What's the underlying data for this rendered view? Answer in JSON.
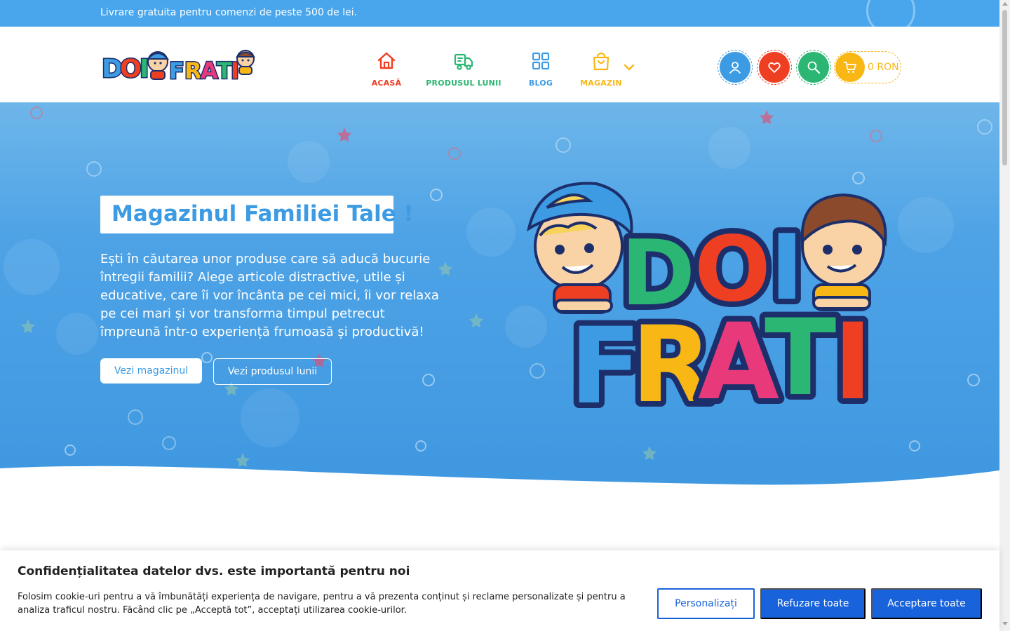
{
  "announcement": {
    "text": "Livrare gratuita pentru comenzi de peste 500 de lei."
  },
  "brand": {
    "logo_alt": "DOI FRAȚI"
  },
  "nav": {
    "items": [
      {
        "label": "ACASĂ",
        "icon": "home-icon",
        "color": "#ef3f23"
      },
      {
        "label": "PRODUSUL LUNII",
        "icon": "delivery-truck-icon",
        "color": "#2bb673"
      },
      {
        "label": "BLOG",
        "icon": "grid-icon",
        "color": "#3c9be3"
      },
      {
        "label": "MAGAZIN",
        "icon": "shopping-bag-icon",
        "color": "#f8b714"
      }
    ]
  },
  "header_actions": {
    "account_icon": "user-icon",
    "wishlist_icon": "heart-icon",
    "search_icon": "search-icon",
    "cart_icon": "cart-icon",
    "cart_total": "0 RON"
  },
  "hero": {
    "title": "Magazinul Familiei Tale !",
    "text": "Ești în căutarea unor produse care să aducă bucurie întregii familii? Alege articole distractive, utile și educative, care îi vor încânta pe cei mici, îi vor relaxa pe cei mari și vor transforma timpul petrecut împreună într-o experiență frumoasă și productivă!",
    "primary_button": "Vezi magazinul",
    "secondary_button": "Vezi produsul lunii",
    "illustration_alt": "DOI FRAȚI"
  },
  "cookie_banner": {
    "title": "Confidențialitatea datelor dvs. este importantă pentru noi",
    "text": "Folosim cookie-uri pentru a vă îmbunătăți experiența de navigare, pentru a vă prezenta conținut și reclame personalizate și pentru a analiza traficul nostru. Făcând clic pe „Acceptă tot”, acceptați utilizarea cookie-urilor.",
    "customize_label": "Personalizați",
    "reject_label": "Refuzare toate",
    "accept_label": "Acceptare toate"
  },
  "colors": {
    "primary_blue": "#3c9be3",
    "red": "#ef3f23",
    "green": "#2bb673",
    "yellow": "#f8b714",
    "cookie_blue": "#1863dc"
  }
}
